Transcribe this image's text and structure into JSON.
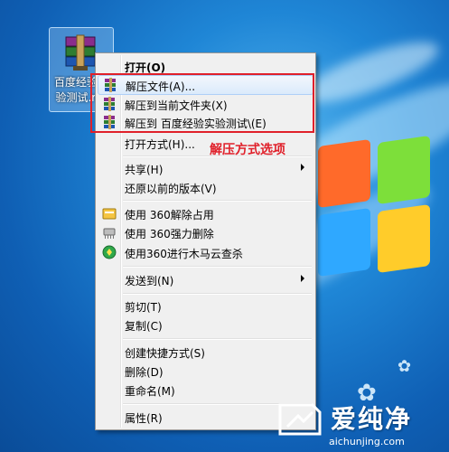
{
  "desktop_icon": {
    "label": "百度经验实\n验测试.rar",
    "icon": "winrar-archive-icon"
  },
  "menu": {
    "items": [
      {
        "label": "打开(O)",
        "bold": true
      },
      {
        "label": "解压文件(A)...",
        "icon": "winrar-icon"
      },
      {
        "label": "解压到当前文件夹(X)",
        "icon": "winrar-icon"
      },
      {
        "label": "解压到 百度经验实验测试\\(E)",
        "icon": "winrar-icon"
      },
      {
        "label": "打开方式(H)..."
      },
      {
        "label": "共享(H)",
        "submenu": true
      },
      {
        "label": "还原以前的版本(V)"
      },
      {
        "label": "使用 360解除占用",
        "icon": "360-unlock-icon"
      },
      {
        "label": "使用 360强力删除",
        "icon": "360-shred-icon"
      },
      {
        "label": "使用360进行木马云查杀",
        "icon": "360-scan-icon"
      },
      {
        "label": "发送到(N)",
        "submenu": true
      },
      {
        "label": "剪切(T)"
      },
      {
        "label": "复制(C)"
      },
      {
        "label": "创建快捷方式(S)"
      },
      {
        "label": "删除(D)"
      },
      {
        "label": "重命名(M)"
      },
      {
        "label": "属性(R)"
      }
    ]
  },
  "annotation": {
    "text": "解压方式选项",
    "color": "#e0202a"
  },
  "watermark": {
    "text": "爱纯净",
    "url": "aichunjing.com"
  }
}
